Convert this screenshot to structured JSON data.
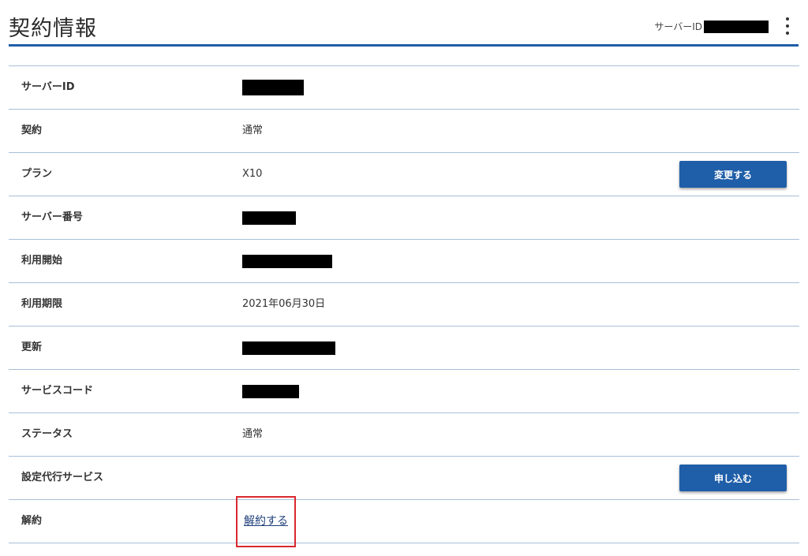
{
  "header": {
    "title": "契約情報",
    "server_id_label": "サーバーID"
  },
  "rows": [
    {
      "label": "サーバーID"
    },
    {
      "label": "契約",
      "value": "通常"
    },
    {
      "label": "プラン",
      "value": "X10",
      "button": "変更する"
    },
    {
      "label": "サーバー番号"
    },
    {
      "label": "利用開始"
    },
    {
      "label": "利用期限",
      "value": "2021年06月30日"
    },
    {
      "label": "更新"
    },
    {
      "label": "サービスコード"
    },
    {
      "label": "ステータス",
      "value": "通常"
    },
    {
      "label": "設定代行サービス",
      "button": "申し込む"
    },
    {
      "label": "解約",
      "link": "解約する"
    }
  ],
  "colors": {
    "accent": "#1f5ea8",
    "highlight": "#d9282f",
    "divider": "#a9bfd9"
  },
  "icons": {
    "menu": "kebab-menu-icon"
  }
}
